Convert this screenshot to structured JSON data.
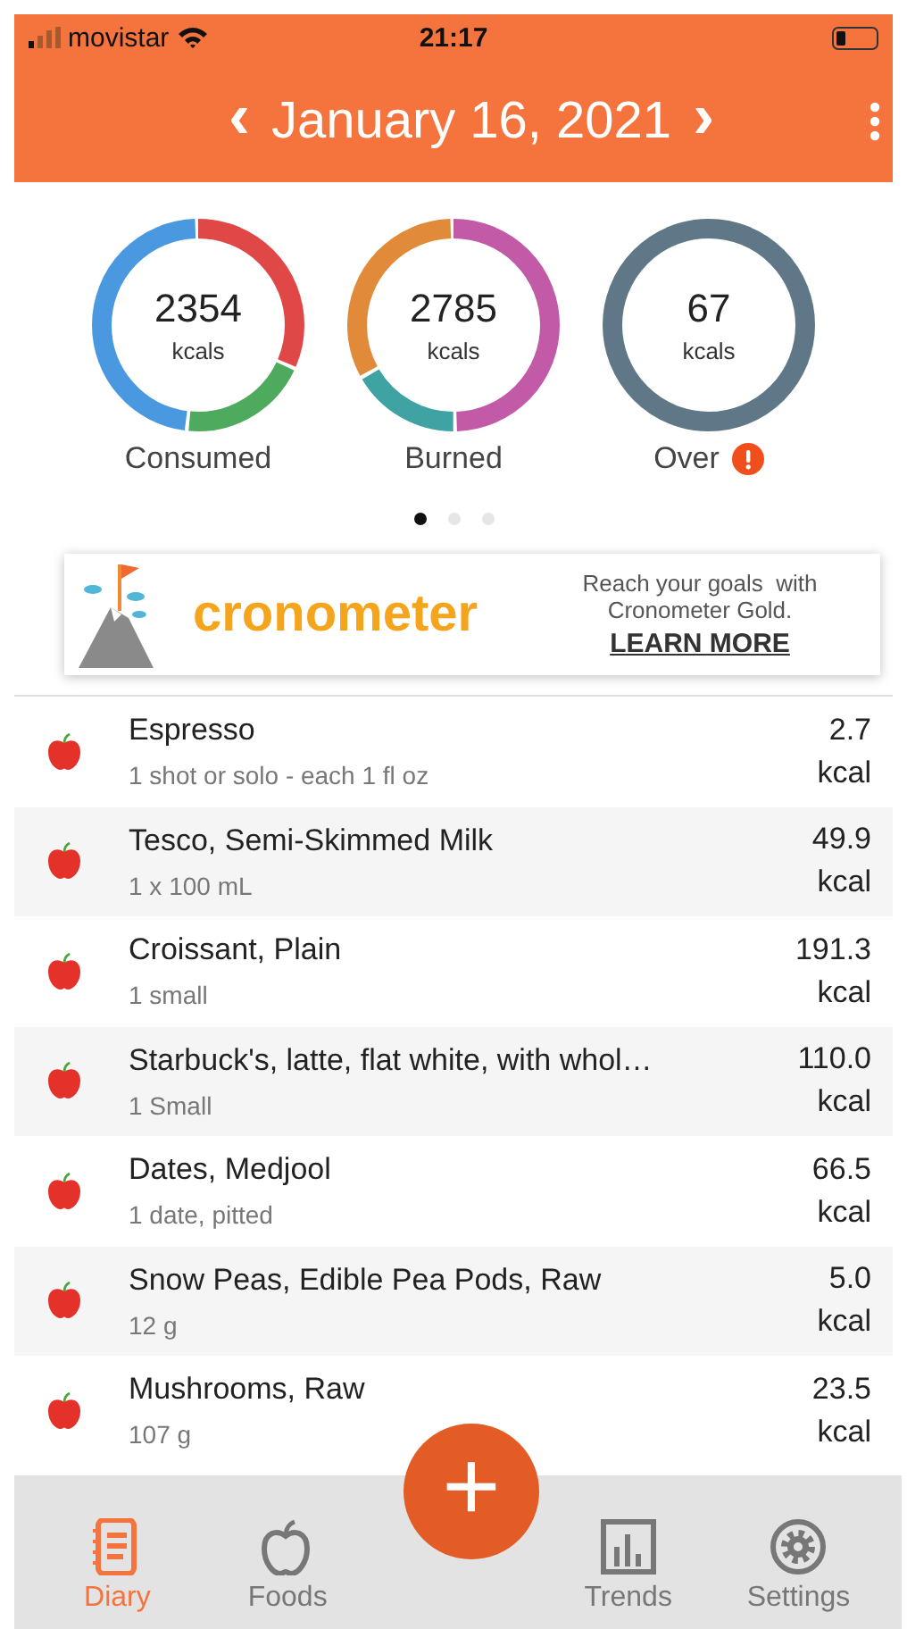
{
  "status_bar": {
    "carrier": "movistar",
    "time": "21:17"
  },
  "header": {
    "prev": "‹",
    "date": "January 16, 2021",
    "next": "›"
  },
  "summary": [
    {
      "value": "2354",
      "unit": "kcals",
      "label": "Consumed",
      "warning": false,
      "segments": [
        {
          "color": "#e04848"
        },
        {
          "color": "#4eaa5c"
        },
        {
          "color": "#4a98e0"
        }
      ]
    },
    {
      "value": "2785",
      "unit": "kcals",
      "label": "Burned",
      "warning": false,
      "segments": [
        {
          "color": "#c25aa8"
        },
        {
          "color": "#3fa3a3"
        },
        {
          "color": "#e08a3a"
        }
      ]
    },
    {
      "value": "67",
      "unit": "kcals",
      "label": "Over",
      "warning": true,
      "segments": [
        {
          "color": "#5f7786"
        }
      ]
    }
  ],
  "pager": [
    {
      "selected": true
    },
    {
      "selected": false
    },
    {
      "selected": false
    }
  ],
  "ad": {
    "logo": "cronometer",
    "text": "Reach your goals  with Cronometer Gold.",
    "link": "LEARN MORE"
  },
  "foods": [
    {
      "name": "Espresso",
      "serving": "1 shot or solo - each 1 fl oz",
      "kcal": "2.7",
      "unit": "kcal"
    },
    {
      "name": "Tesco, Semi-Skimmed Milk",
      "serving": "1 x 100 mL",
      "kcal": "49.9",
      "unit": "kcal"
    },
    {
      "name": "Croissant, Plain",
      "serving": "1 small",
      "kcal": "191.3",
      "unit": "kcal"
    },
    {
      "name": "Starbuck's, latte, flat white, with whol…",
      "serving": "1 Small",
      "kcal": "110.0",
      "unit": "kcal"
    },
    {
      "name": "Dates, Medjool",
      "serving": "1 date, pitted",
      "kcal": "66.5",
      "unit": "kcal"
    },
    {
      "name": "Snow Peas, Edible Pea Pods, Raw",
      "serving": "12 g",
      "kcal": "5.0",
      "unit": "kcal"
    },
    {
      "name": "Mushrooms, Raw",
      "serving": "107 g",
      "kcal": "23.5",
      "unit": "kcal"
    }
  ],
  "fab": "+",
  "tabs": [
    {
      "label": "Diary",
      "kind": "diary",
      "selected": true
    },
    {
      "label": "Foods",
      "kind": "foods",
      "selected": false
    },
    {
      "kind": "gap"
    },
    {
      "label": "Trends",
      "kind": "trends",
      "selected": false
    },
    {
      "label": "Settings",
      "kind": "settings",
      "selected": false
    }
  ]
}
